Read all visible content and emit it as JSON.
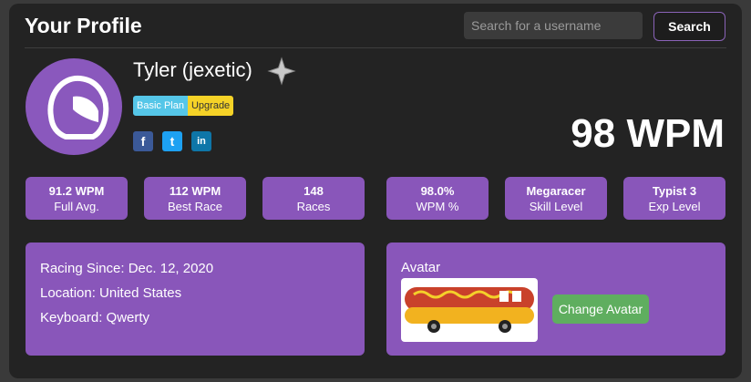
{
  "header": {
    "title": "Your Profile",
    "search_placeholder": "Search for a username",
    "search_label": "Search"
  },
  "profile": {
    "name": "Tyler (jexetic)",
    "plan": "Basic Plan",
    "upgrade": "Upgrade",
    "wpm": "98 WPM",
    "social": [
      {
        "icon": "facebook-icon",
        "glyph": "f",
        "color": "#3b5998"
      },
      {
        "icon": "twitter-icon",
        "glyph": "t",
        "color": "#1da1f2"
      },
      {
        "icon": "linkedin-icon",
        "glyph": "in",
        "color": "#0e76a8"
      }
    ]
  },
  "stats": [
    {
      "value": "91.2 WPM",
      "label": "Full Avg."
    },
    {
      "value": "112 WPM",
      "label": "Best Race"
    },
    {
      "value": "148",
      "label": "Races"
    },
    {
      "value": "98.0%",
      "label": "WPM %"
    },
    {
      "value": "Megaracer",
      "label": "Skill Level"
    },
    {
      "value": "Typist 3",
      "label": "Exp Level"
    }
  ],
  "info": {
    "racing_since": "Racing Since: Dec. 12, 2020",
    "location": "Location: United States",
    "keyboard": "Keyboard: Qwerty"
  },
  "avatar_panel": {
    "label": "Avatar",
    "change_label": "Change Avatar"
  },
  "colors": {
    "accent": "#8956ba",
    "background": "#232323",
    "button_green": "#5fae5f"
  }
}
